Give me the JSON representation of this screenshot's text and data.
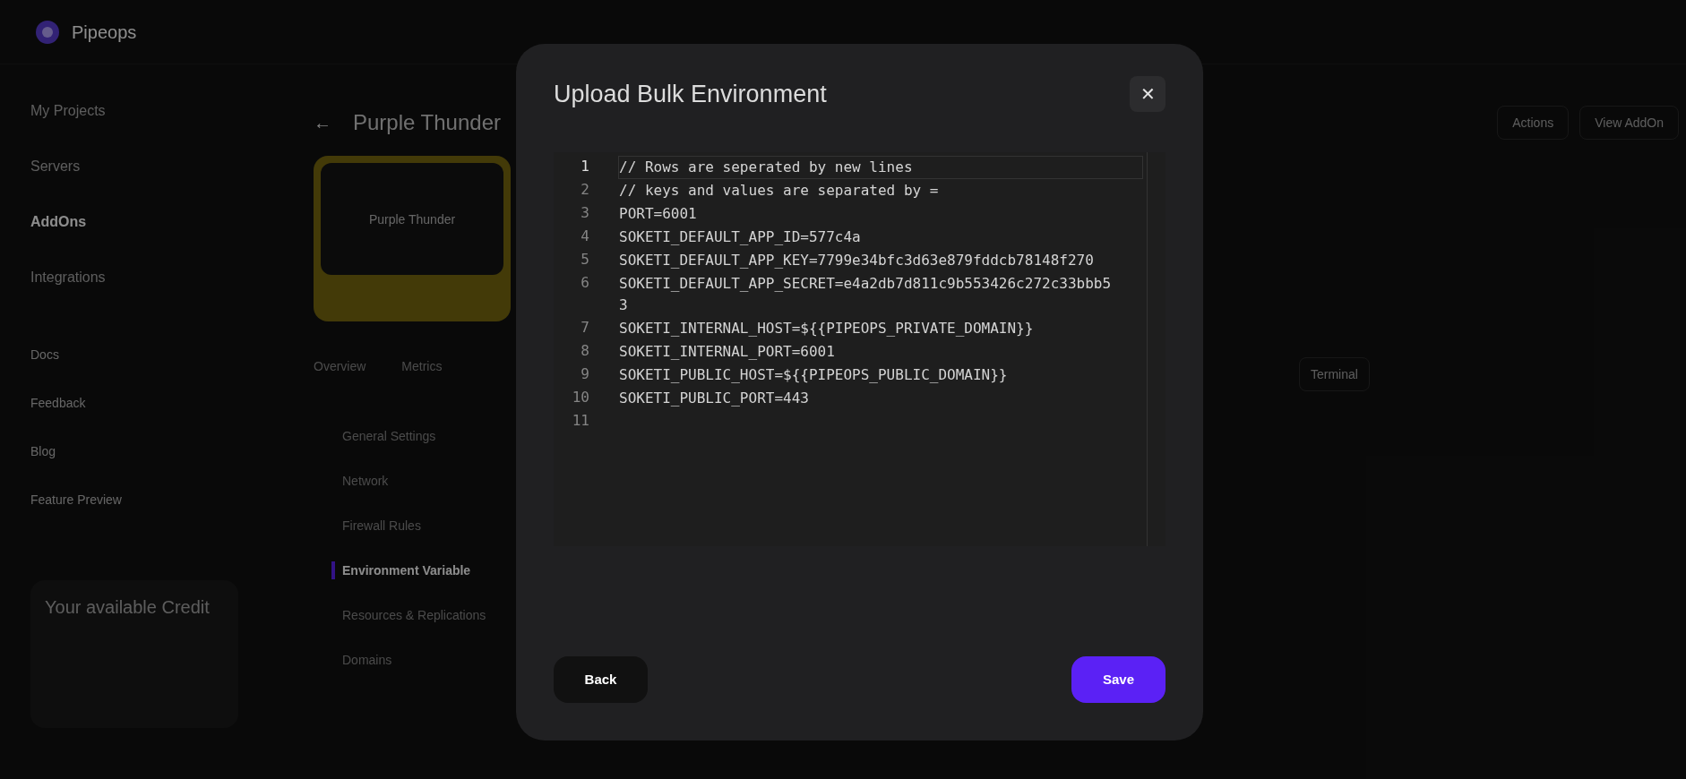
{
  "app": {
    "brand": "Pipeops",
    "nav": [
      {
        "label": "My Projects",
        "selected": false
      },
      {
        "label": "Servers",
        "selected": false
      },
      {
        "label": "AddOns",
        "selected": true
      },
      {
        "label": "Integrations",
        "selected": false
      }
    ],
    "links": [
      "Docs",
      "Feedback",
      "Blog",
      "Feature Preview"
    ],
    "credit_title": "Your available Credit",
    "back": "←",
    "page_title": "Purple Thunder",
    "card_title": "Purple Thunder",
    "tabs": [
      "Overview",
      "Metrics"
    ],
    "settings": [
      {
        "label": "General Settings",
        "selected": false
      },
      {
        "label": "Network",
        "selected": false
      },
      {
        "label": "Firewall Rules",
        "selected": false
      },
      {
        "label": "Environment Variable",
        "selected": true
      },
      {
        "label": "Resources & Replications",
        "selected": false
      },
      {
        "label": "Domains",
        "selected": false
      }
    ],
    "actions": [
      "Actions",
      "View AddOn"
    ],
    "terminal": "Terminal"
  },
  "modal": {
    "title": "Upload Bulk Environment",
    "close": "✕",
    "lines": [
      {
        "number": "1",
        "text": "// Rows are seperated by new lines",
        "current": true
      },
      {
        "number": "2",
        "text": "// keys and values are separated by =",
        "current": false
      },
      {
        "number": "3",
        "text": "PORT=6001",
        "current": false
      },
      {
        "number": "4",
        "text": "SOKETI_DEFAULT_APP_ID=577c4a",
        "current": false
      },
      {
        "number": "5",
        "text": "SOKETI_DEFAULT_APP_KEY=7799e34bfc3d63e879fddcb78148f270",
        "current": false
      },
      {
        "number": "6",
        "text": "SOKETI_DEFAULT_APP_SECRET=e4a2db7d811c9b553426c272c33bbb53",
        "current": false
      },
      {
        "number": "7",
        "text": "SOKETI_INTERNAL_HOST=${{PIPEOPS_PRIVATE_DOMAIN}}",
        "current": false
      },
      {
        "number": "8",
        "text": "SOKETI_INTERNAL_PORT=6001",
        "current": false
      },
      {
        "number": "9",
        "text": "SOKETI_PUBLIC_HOST=${{PIPEOPS_PUBLIC_DOMAIN}}",
        "current": false
      },
      {
        "number": "10",
        "text": "SOKETI_PUBLIC_PORT=443",
        "current": false
      },
      {
        "number": "11",
        "current": false
      }
    ],
    "buttons": [
      {
        "label": "Back",
        "kind": "secondary"
      },
      {
        "label": "Save",
        "kind": "primary"
      }
    ]
  }
}
